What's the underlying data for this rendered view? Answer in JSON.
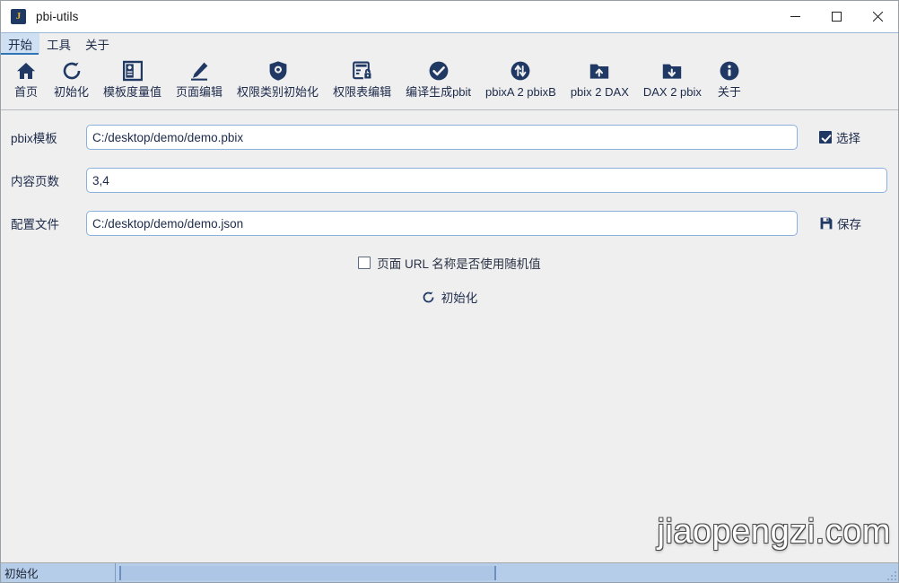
{
  "window": {
    "title": "pbi-utils",
    "icon_letter": "J",
    "icon_name": "app-icon-j",
    "minimize_label": "—",
    "maximize_label": "☐",
    "close_label": "✕"
  },
  "menubar": {
    "items": [
      {
        "label": "开始",
        "name": "menu-start",
        "active": true
      },
      {
        "label": "工具",
        "name": "menu-tools",
        "active": false
      },
      {
        "label": "关于",
        "name": "menu-about",
        "active": false
      }
    ]
  },
  "toolbar": {
    "items": [
      {
        "label": "首页",
        "icon": "home-icon"
      },
      {
        "label": "初始化",
        "icon": "reset-icon"
      },
      {
        "label": "模板度量值",
        "icon": "template-measure-icon"
      },
      {
        "label": "页面编辑",
        "icon": "pencil-icon"
      },
      {
        "label": "权限类别初始化",
        "icon": "shield-icon"
      },
      {
        "label": "权限表编辑",
        "icon": "table-lock-icon"
      },
      {
        "label": "编译生成pbit",
        "icon": "check-circle-icon"
      },
      {
        "label": "pbixA 2 pbixB",
        "icon": "swap-arrows-icon"
      },
      {
        "label": "pbix 2 DAX",
        "icon": "folder-up-icon"
      },
      {
        "label": "DAX 2 pbix",
        "icon": "folder-down-icon"
      },
      {
        "label": "关于",
        "icon": "info-icon"
      }
    ]
  },
  "form": {
    "rows": [
      {
        "label": "pbix模板",
        "value": "C:/desktop/demo/demo.pbix",
        "placeholder": "",
        "input_name": "pbix-template-input",
        "action": {
          "type": "checkbox",
          "label": "选择",
          "checked": true,
          "name": "select-checkbox"
        }
      },
      {
        "label": "内容页数",
        "value": "3,4",
        "placeholder": "",
        "input_name": "content-pages-input",
        "action": null
      },
      {
        "label": "配置文件",
        "value": "C:/desktop/demo/demo.json",
        "placeholder": "",
        "input_name": "config-file-input",
        "action": {
          "type": "button",
          "label": "保存",
          "icon": "save-icon",
          "name": "save-button"
        }
      }
    ],
    "random_url_checkbox": {
      "label": "页面 URL 名称是否使用随机值",
      "checked": false
    },
    "init_button": {
      "label": "初始化",
      "icon": "reset-icon"
    }
  },
  "statusbar": {
    "message": "初始化",
    "progress_percent": 0
  },
  "watermark": {
    "text": "jiaopengzi.com"
  },
  "colors": {
    "accent": "#1f3864",
    "tab_active_bg": "#cfe0f2",
    "accent_underline": "#2e75b6",
    "input_border": "#8ab0dd",
    "status_bg": "#b6cde9",
    "window_bg": "#efefef"
  }
}
